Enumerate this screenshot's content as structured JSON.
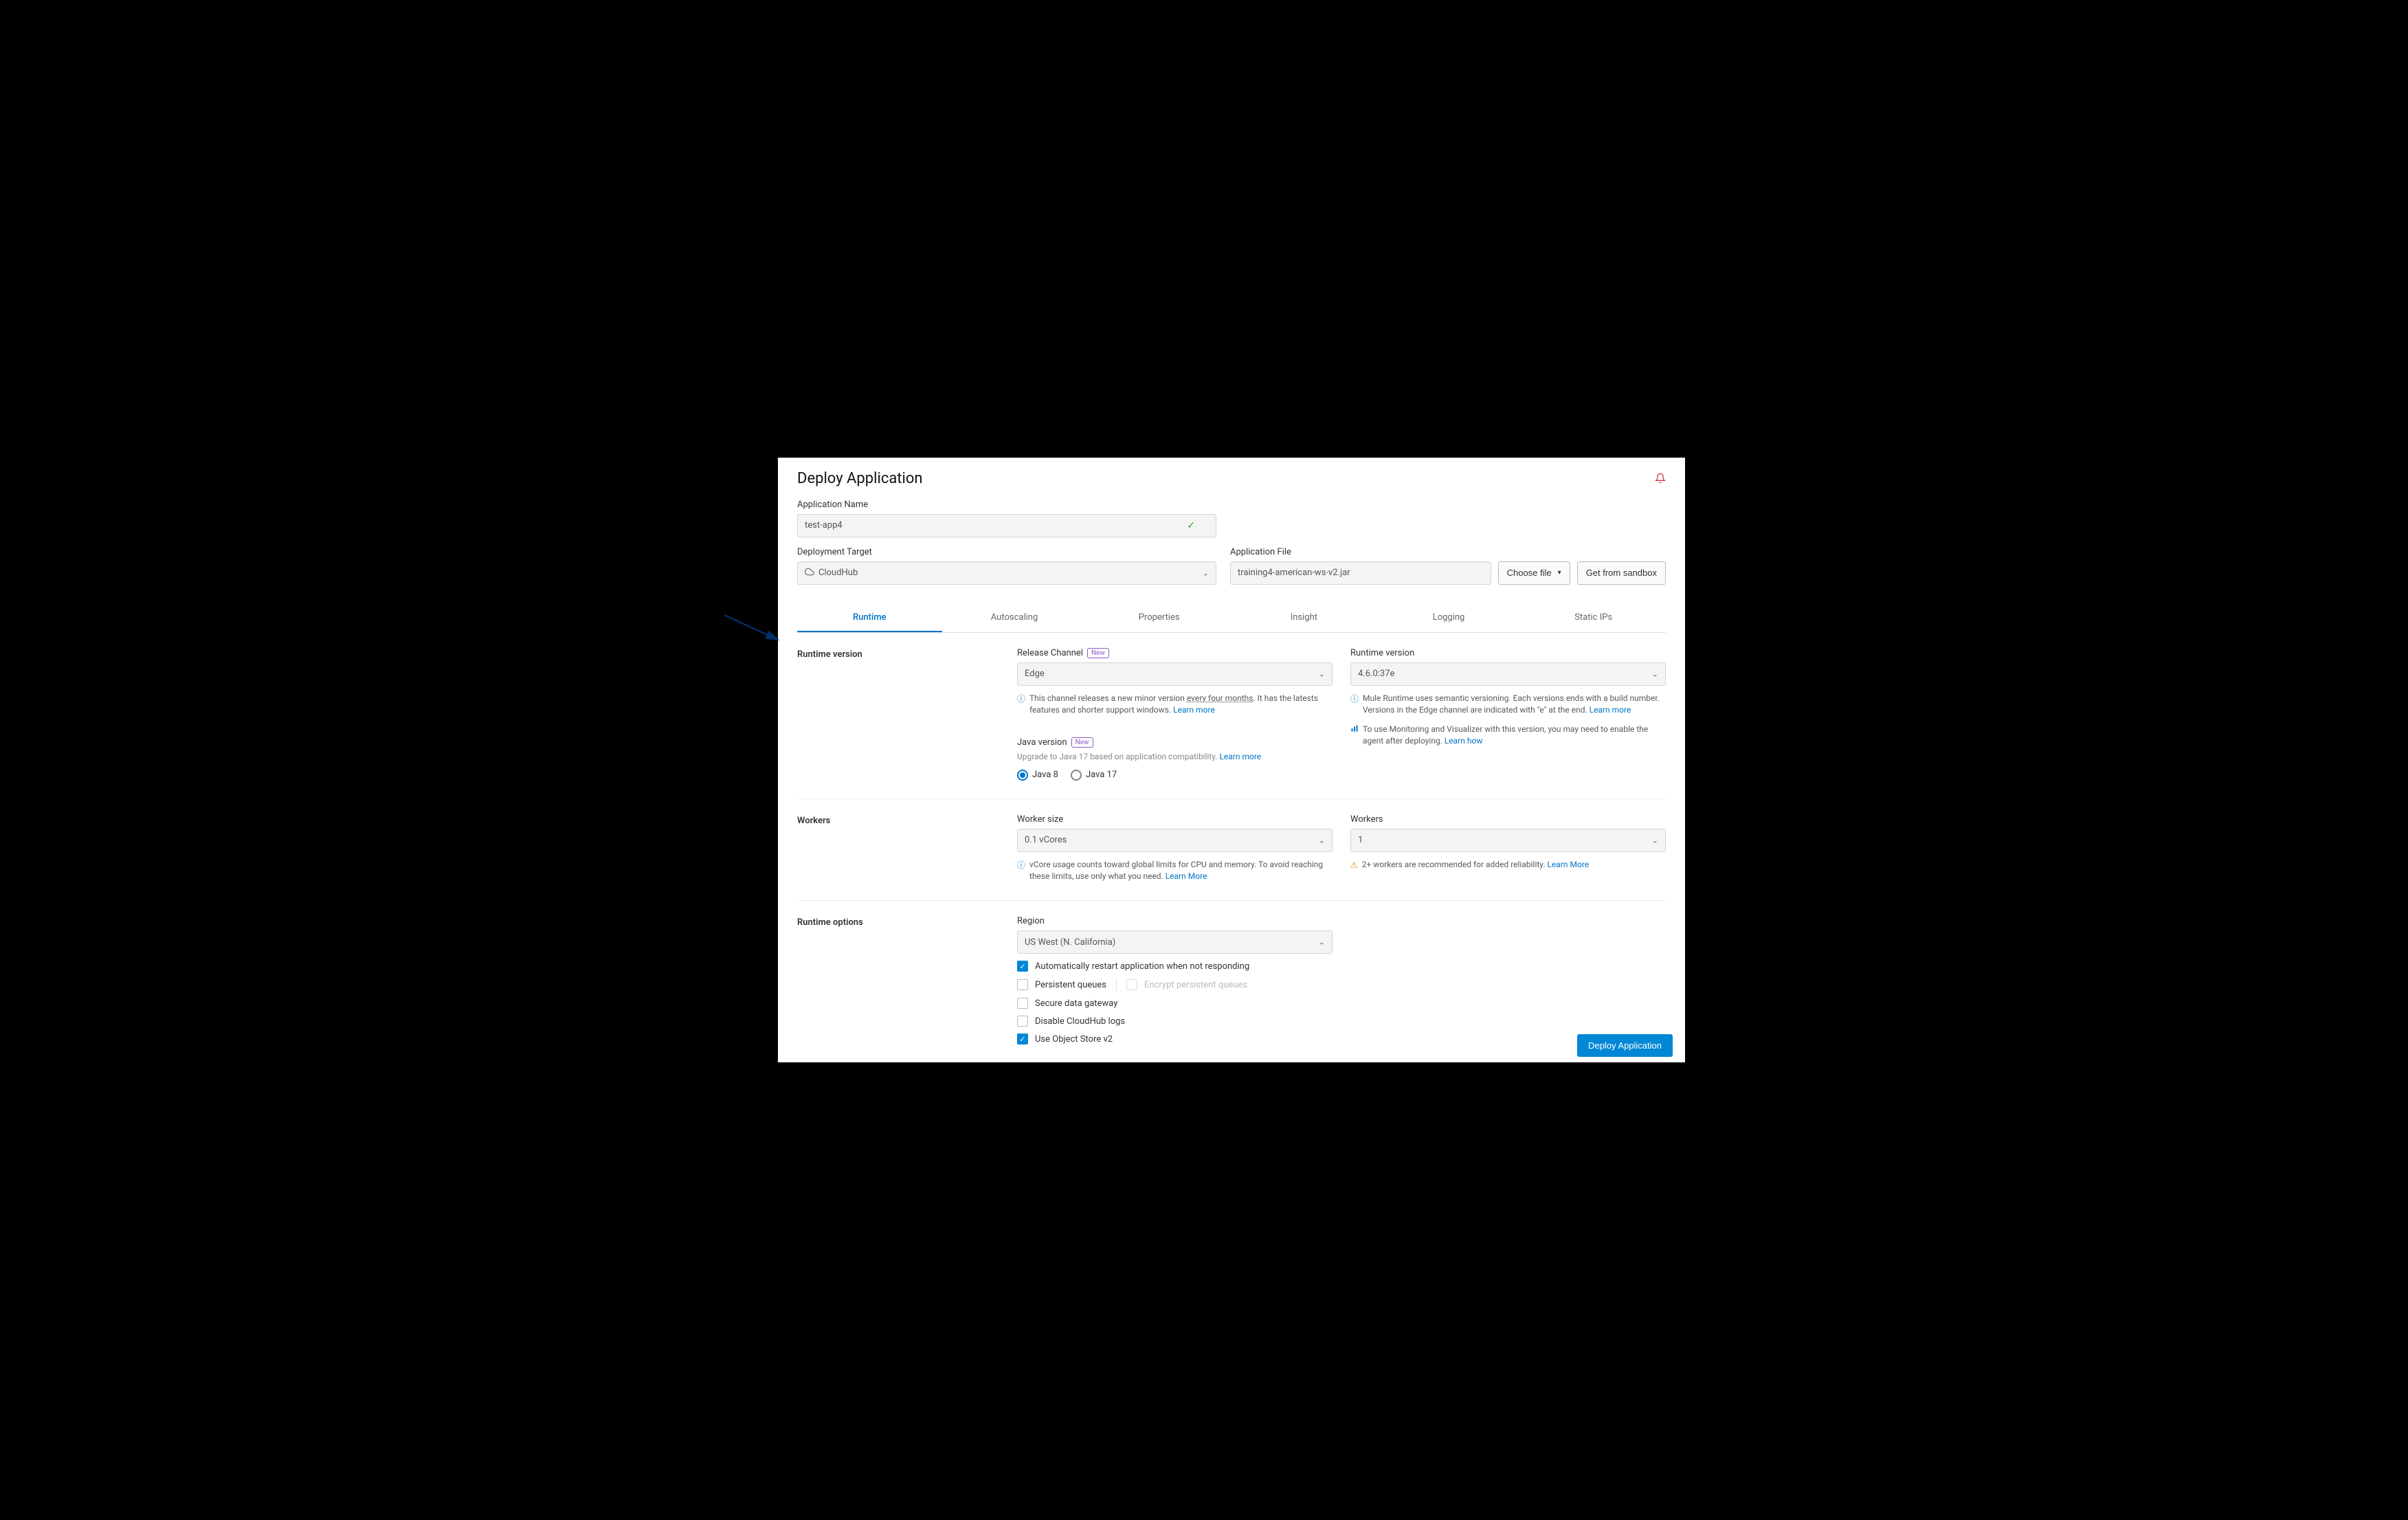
{
  "header": {
    "title": "Deploy Application"
  },
  "appName": {
    "label": "Application Name",
    "value": "test-app4"
  },
  "deployTarget": {
    "label": "Deployment Target",
    "value": "CloudHub"
  },
  "appFile": {
    "label": "Application File",
    "value": "training4-american-ws-v2.jar",
    "chooseFile": "Choose file",
    "getFromSandbox": "Get from sandbox"
  },
  "tabs": [
    "Runtime",
    "Autoscaling",
    "Properties",
    "Insight",
    "Logging",
    "Static IPs"
  ],
  "runtimeSection": {
    "label": "Runtime version",
    "releaseChannel": {
      "label": "Release Channel",
      "badge": "New",
      "value": "Edge",
      "infoPre": "This channel releases a new minor version ",
      "infoUnderline": "every four months",
      "infoPost": ". It has the latests features and shorter support windows. ",
      "learnMore": "Learn more"
    },
    "runtimeVersion": {
      "label": "Runtime version",
      "value": "4.6.0:37e",
      "info1": "Mule Runtime uses semantic versioning. Each versions ends with a build number. Versions in the Edge channel are indicated with \"e\" at the end. ",
      "learnMore1": "Learn more",
      "info2": "To use Monitoring and Visualizer with this version, you may need to enable the agent after deploying. ",
      "learnHow": "Learn how"
    },
    "javaVersion": {
      "label": "Java version",
      "badge": "New",
      "subtext": "Upgrade to Java 17 based on application compatibility. ",
      "learnMore": "Learn more",
      "options": [
        "Java 8",
        "Java 17"
      ],
      "selected": "Java 8"
    }
  },
  "workersSection": {
    "label": "Workers",
    "workerSize": {
      "label": "Worker size",
      "value": "0.1 vCores",
      "info": "vCore usage counts toward global limits for CPU and memory. To avoid reaching these limits, use only what you need. ",
      "learnMore": "Learn More"
    },
    "workers": {
      "label": "Workers",
      "value": "1",
      "warn": "2+ workers are recommended for added reliability. ",
      "learnMore": "Learn More"
    }
  },
  "runtimeOptions": {
    "label": "Runtime options",
    "region": {
      "label": "Region",
      "value": "US West (N. California)"
    },
    "checks": {
      "autoRestart": "Automatically restart application when not responding",
      "persistentQueues": "Persistent queues",
      "encryptQueues": "Encrypt persistent queues",
      "secureGateway": "Secure data gateway",
      "disableLogs": "Disable CloudHub logs",
      "objectStore": "Use Object Store v2"
    }
  },
  "deployButton": "Deploy Application"
}
